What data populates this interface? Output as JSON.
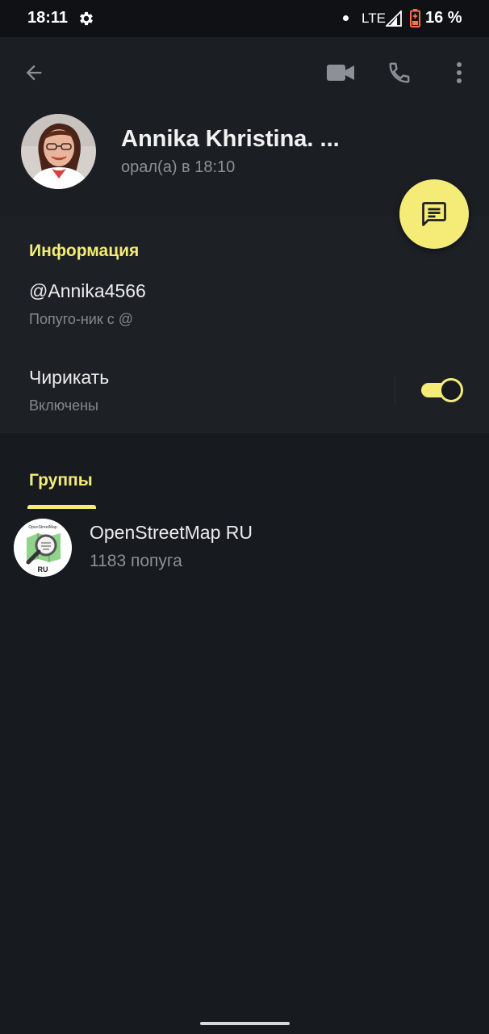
{
  "status_bar": {
    "time": "18:11",
    "network": "LTE",
    "battery": "16 %"
  },
  "toolbar": {
    "back_icon": "arrow-left-icon",
    "video_icon": "video-camera-icon",
    "call_icon": "phone-icon",
    "more_icon": "more-vertical-icon"
  },
  "profile": {
    "name": "Annika Khristina. ...",
    "status": "орал(а) в 18:10"
  },
  "fab_icon": "message-icon",
  "info": {
    "title": "Информация",
    "username": "@Annika4566",
    "username_caption": "Попуго-ник с @",
    "notifications_label": "Чирикать",
    "notifications_state": "Включены",
    "notifications_enabled": true
  },
  "groups": {
    "tab_label": "Группы",
    "items": [
      {
        "name": "OpenStreetMap RU",
        "members": "1183 попуга",
        "avatar_text": "RU",
        "avatar_ring_text": "OpenStreetMap"
      }
    ]
  },
  "colors": {
    "accent": "#f4ec77",
    "background": "#171a1f",
    "header": "#1b1e23",
    "card": "#1d2025"
  }
}
